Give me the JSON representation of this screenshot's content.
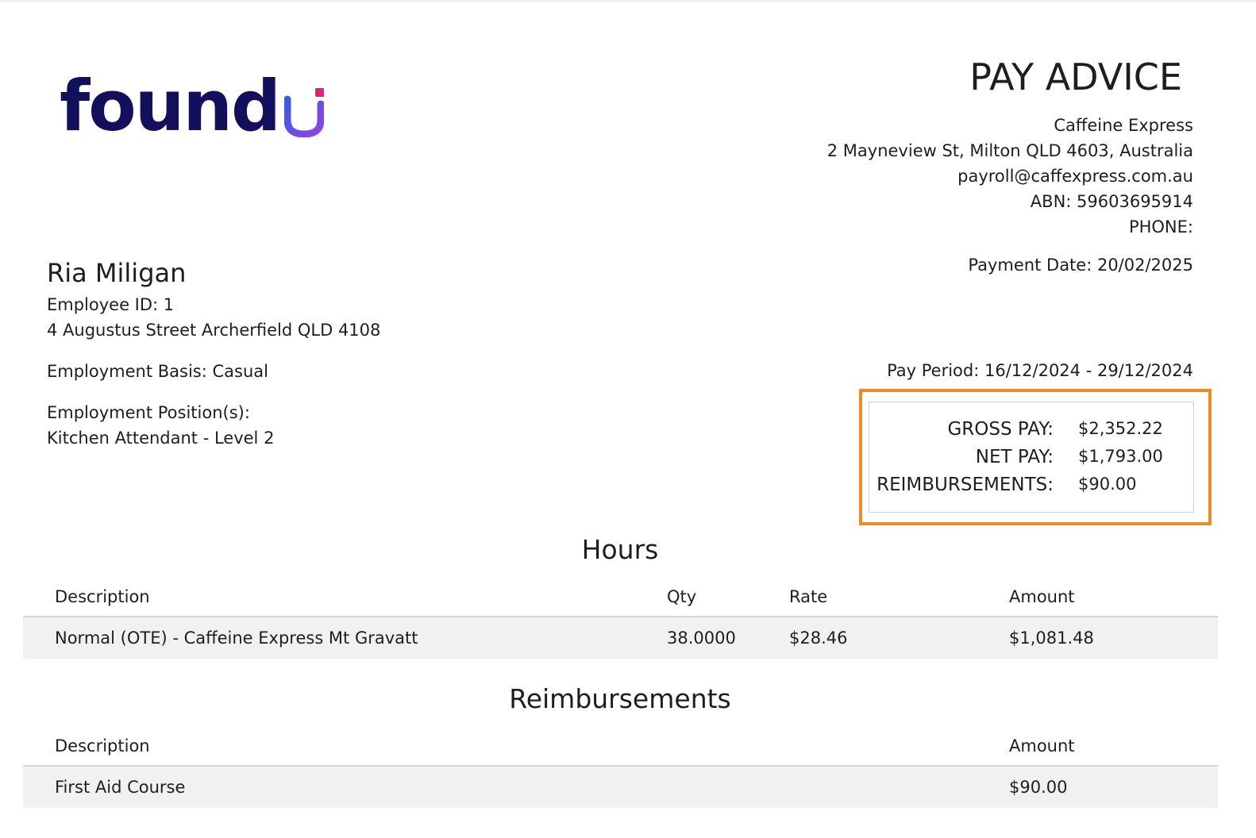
{
  "logo": {
    "text": "found",
    "accent_letter": "U",
    "brand_color": "#12105c",
    "accent_gradient": [
      "#3b5bdb",
      "#8e44e8"
    ],
    "dot_color": "#e91e78"
  },
  "document": {
    "title": "PAY ADVICE"
  },
  "employer": {
    "name": "Caffeine Express",
    "address": "2 Mayneview St, Milton QLD 4603, Australia",
    "email": "payroll@caffexpress.com.au",
    "abn": "ABN: 59603695914",
    "phone": "PHONE:"
  },
  "payment_date": "Payment Date: 20/02/2025",
  "pay_period": "Pay Period: 16/12/2024 - 29/12/2024",
  "employee": {
    "name": "Ria Miligan",
    "id": "Employee ID: 1",
    "address": "4 Augustus Street Archerfield QLD 4108",
    "basis": "Employment Basis: Casual",
    "positions_label": "Employment Position(s):",
    "position": "Kitchen Attendant - Level 2"
  },
  "summary": {
    "highlight_color": "#f28a22",
    "rows": [
      {
        "label": "GROSS PAY:",
        "value": "$2,352.22"
      },
      {
        "label": "NET PAY:",
        "value": "$1,793.00"
      },
      {
        "label": "REIMBURSEMENTS:",
        "value": "$90.00"
      }
    ]
  },
  "hours": {
    "title": "Hours",
    "headers": {
      "description": "Description",
      "qty": "Qty",
      "rate": "Rate",
      "amount": "Amount"
    },
    "rows": [
      {
        "description": "Normal (OTE) - Caffeine Express Mt Gravatt",
        "qty": "38.0000",
        "rate": "$28.46",
        "amount": "$1,081.48"
      }
    ]
  },
  "reimbursements": {
    "title": "Reimbursements",
    "headers": {
      "description": "Description",
      "amount": "Amount"
    },
    "rows": [
      {
        "description": "First Aid Course",
        "amount": "$90.00"
      }
    ]
  }
}
